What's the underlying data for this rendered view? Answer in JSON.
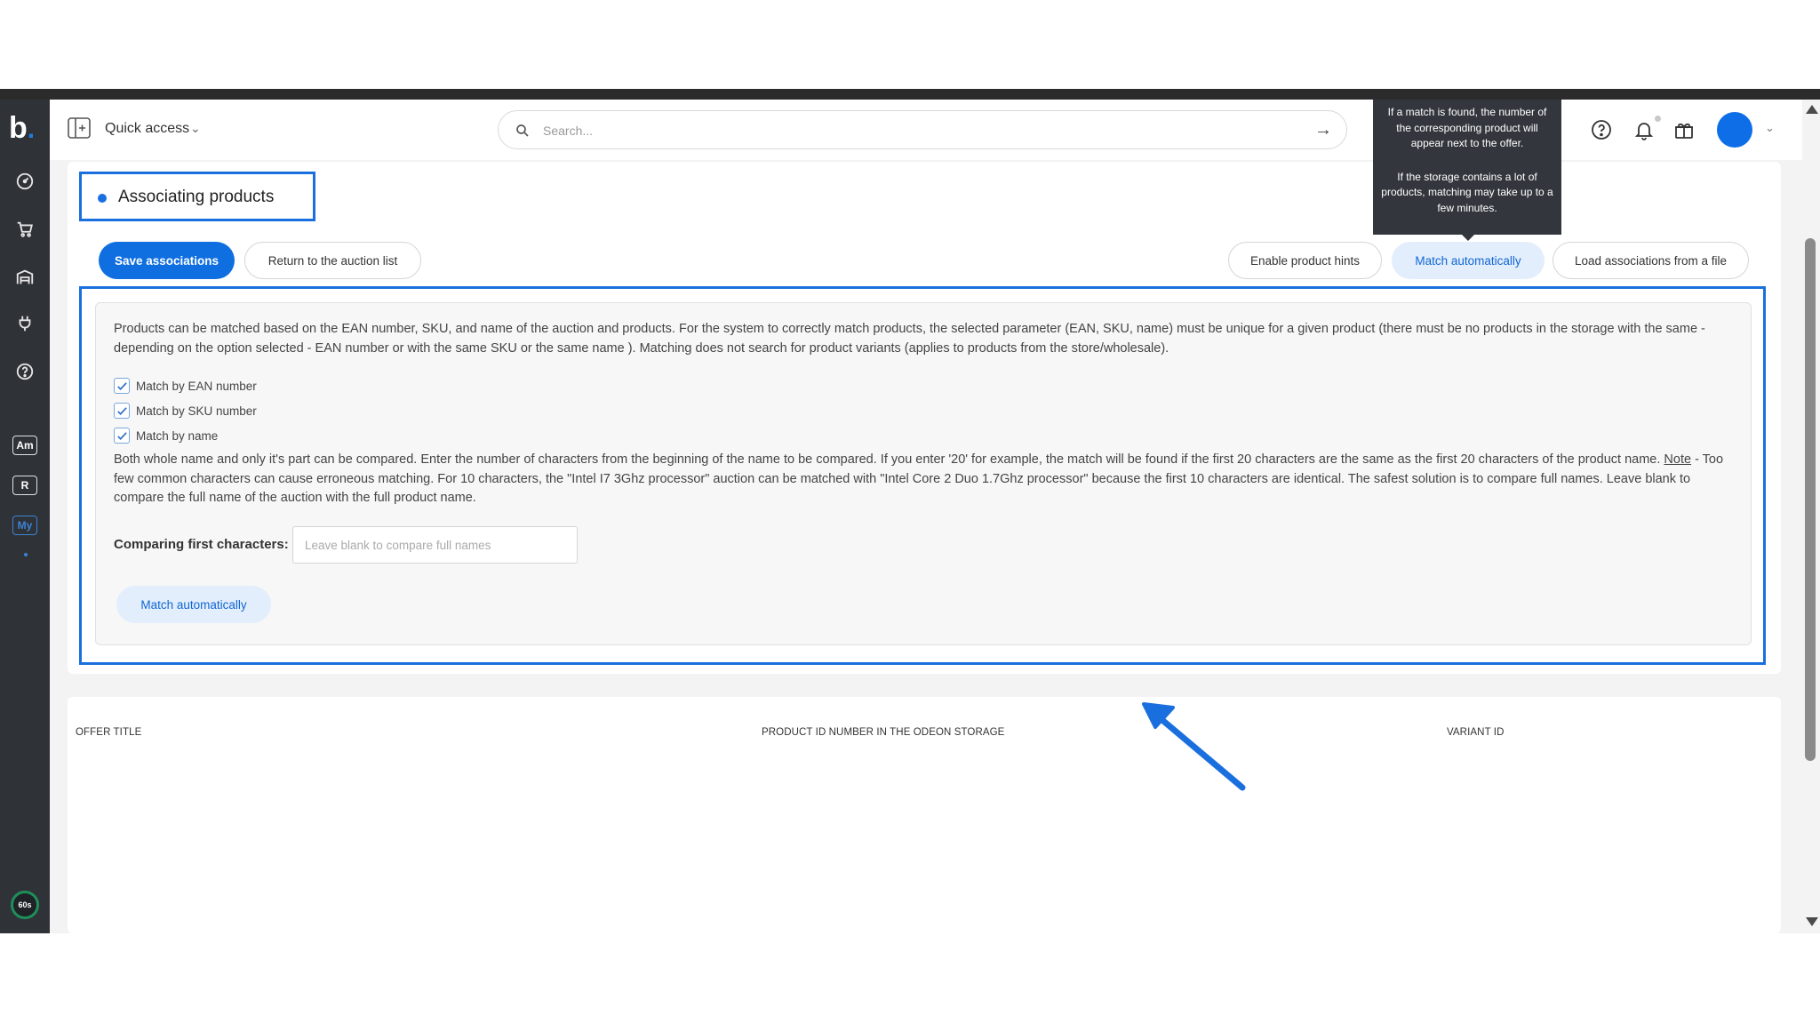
{
  "header": {
    "quick_access_label": "Quick access",
    "search_placeholder": "Search..."
  },
  "sidebar": {
    "logo_letter": "b",
    "logo_dot": ".",
    "items": [
      {
        "icon": "gauge-icon"
      },
      {
        "icon": "cart-icon"
      },
      {
        "icon": "warehouse-icon"
      },
      {
        "icon": "plug-icon"
      },
      {
        "icon": "help-icon"
      }
    ],
    "badges": [
      {
        "label": "Am"
      },
      {
        "label": "R"
      },
      {
        "label": "My"
      }
    ],
    "timer_label": "60s"
  },
  "tooltip": {
    "line1": "If a match is found, the number of the corresponding product will appear next to the offer.",
    "line2": "If the storage contains a lot of products, matching may take up to a few minutes."
  },
  "page": {
    "title": "Associating products"
  },
  "toolbar": {
    "save_associations": "Save associations",
    "return_to_list": "Return to the auction list",
    "enable_hints": "Enable product hints",
    "match_automatically": "Match automatically",
    "load_from_file": "Load associations from a file"
  },
  "match_panel": {
    "description": "Products can be matched based on the EAN number, SKU, and name of the auction and products. For the system to correctly match products, the selected parameter (EAN, SKU, name) must be unique for a given product (there must be no products in the storage with the same - depending on the option selected - EAN number or with the same SKU or the same name ). Matching does not search for product variants (applies to products from the store/wholesale).",
    "options": [
      {
        "label": "Match by EAN number",
        "checked": true
      },
      {
        "label": "Match by SKU number",
        "checked": true
      },
      {
        "label": "Match by name",
        "checked": true
      }
    ],
    "name_note_before": "Both whole name and only it's part can be compared. Enter the number of characters from the beginning of the name to be compared. If you enter '20' for example, the match will be found if the first 20 characters are the same as the first 20 characters of the product name. ",
    "name_note_link": "Note",
    "name_note_after": " - Too few common characters can cause erroneous matching. For 10 characters, the \"Intel I7 3Ghz processor\" auction can be matched with \"Intel Core 2 Duo 1.7Ghz processor\" because the first 10 characters are identical. The safest solution is to compare full names. Leave blank to compare the full name of the auction with the full product name.",
    "comparing_label": "Comparing first characters:",
    "comparing_placeholder": "Leave blank to compare full names",
    "comparing_value": "",
    "match_button": "Match automatically"
  },
  "table": {
    "columns": [
      "OFFER TITLE",
      "PRODUCT ID NUMBER IN THE ODEON STORAGE",
      "VARIANT ID"
    ]
  },
  "colors": {
    "accent": "#0f6fe0",
    "highlight_frame": "#1a6fde",
    "sidebar_bg": "#2f3338",
    "tooltip_bg": "#33373d"
  }
}
